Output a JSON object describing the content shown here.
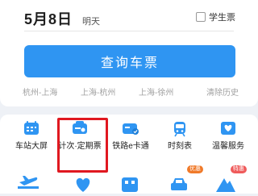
{
  "search": {
    "date": "5月8日",
    "weekday": "明天",
    "student_label": "学生票",
    "query_button": "查询车票",
    "history": [
      "杭州-上海",
      "上海-杭州",
      "上海-徐州"
    ],
    "clear_history": "清除历史"
  },
  "services": [
    {
      "label": "车站大屏",
      "icon": "station-screen-icon"
    },
    {
      "label": "计次·定期票",
      "icon": "ticket-card-icon"
    },
    {
      "label": "铁路e卡通",
      "icon": "e-card-icon"
    },
    {
      "label": "时刻表",
      "icon": "train-icon"
    },
    {
      "label": "温馨服务",
      "icon": "heart-service-icon"
    }
  ],
  "badges": [
    "优惠",
    "特惠"
  ],
  "colors": {
    "primary": "#2f95f2",
    "highlight": "#e01820",
    "badge_orange": "#f07a2a",
    "badge_red": "#ef5b5b"
  }
}
